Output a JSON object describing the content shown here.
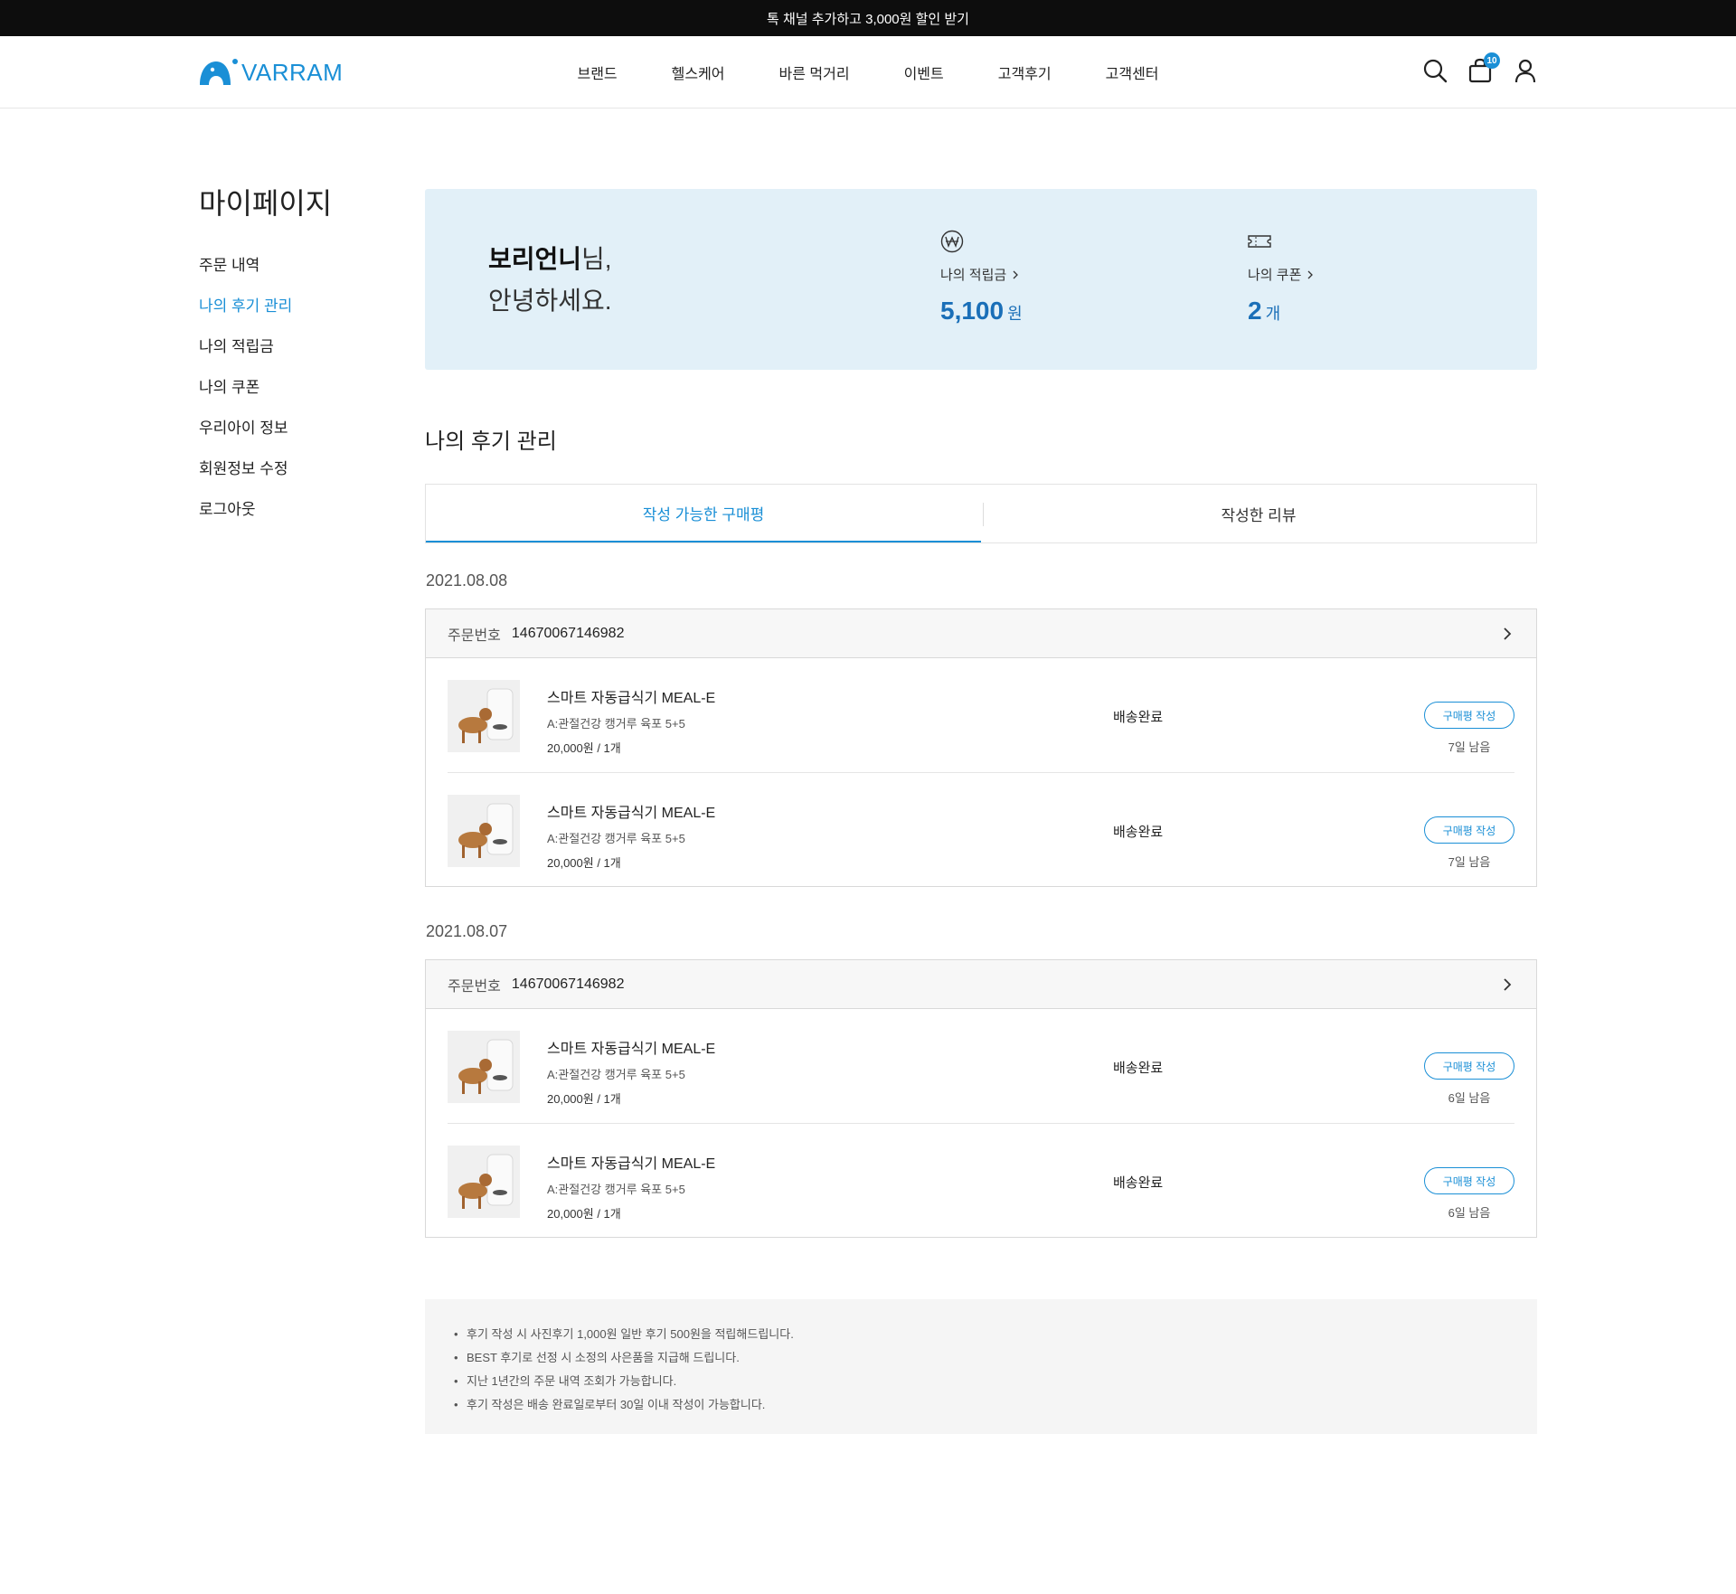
{
  "promo": {
    "text": "톡 채널 추가하고 3,000원 할인 받기"
  },
  "header": {
    "logo_text": "VARRAM",
    "nav": [
      "브랜드",
      "헬스케어",
      "바른 먹거리",
      "이벤트",
      "고객후기",
      "고객센터"
    ],
    "cart_count": "10",
    "icons": [
      "search-icon",
      "cart-icon",
      "user-icon"
    ]
  },
  "sidebar": {
    "title": "마이페이지",
    "items": [
      {
        "label": "주문 내역",
        "active": false
      },
      {
        "label": "나의 후기 관리",
        "active": true
      },
      {
        "label": "나의 적립금",
        "active": false
      },
      {
        "label": "나의 쿠폰",
        "active": false
      },
      {
        "label": "우리아이 정보",
        "active": false
      },
      {
        "label": "회원정보 수정",
        "active": false
      },
      {
        "label": "로그아웃",
        "active": false
      }
    ]
  },
  "welcome": {
    "name": "보리언니",
    "suffix": "님,",
    "line2": "안녕하세요.",
    "points": {
      "label": "나의 적립금",
      "value": "5,100",
      "unit": "원",
      "icon": "won-icon"
    },
    "coupons": {
      "label": "나의 쿠폰",
      "value": "2",
      "unit": "개",
      "icon": "ticket-icon"
    }
  },
  "section": {
    "title": "나의 후기 관리",
    "tabs": [
      {
        "label": "작성 가능한 구매평",
        "active": true
      },
      {
        "label": "작성한 리뷰",
        "active": false
      }
    ]
  },
  "orders": [
    {
      "date": "2021.08.08",
      "order_label": "주문번호",
      "order_no": "14670067146982",
      "items": [
        {
          "name": "스마트 자동급식기 MEAL-E",
          "option": "A:관절건강 캥거루 육포 5+5",
          "price": "20,000원 / 1개",
          "status": "배송완료",
          "button": "구매평 작성",
          "remain": "7일 남음"
        },
        {
          "name": "스마트 자동급식기 MEAL-E",
          "option": "A:관절건강 캥거루 육포 5+5",
          "price": "20,000원 / 1개",
          "status": "배송완료",
          "button": "구매평 작성",
          "remain": "7일 남음"
        }
      ]
    },
    {
      "date": "2021.08.07",
      "order_label": "주문번호",
      "order_no": "14670067146982",
      "items": [
        {
          "name": "스마트 자동급식기 MEAL-E",
          "option": "A:관절건강 캥거루 육포 5+5",
          "price": "20,000원 / 1개",
          "status": "배송완료",
          "button": "구매평 작성",
          "remain": "6일 남음"
        },
        {
          "name": "스마트 자동급식기 MEAL-E",
          "option": "A:관절건강 캥거루 육포 5+5",
          "price": "20,000원 / 1개",
          "status": "배송완료",
          "button": "구매평 작성",
          "remain": "6일 남음"
        }
      ]
    }
  ],
  "notice": [
    "후기 작성 시 사진후기 1,000원 일반 후기 500원을 적립해드립니다.",
    "BEST 후기로 선정 시 소정의 사은품을 지급해 드립니다.",
    "지난 1년간의 주문 내역 조회가 가능합니다.",
    "후기 작성은 배송 완료일로부터 30일 이내 작성이 가능합니다."
  ],
  "colors": {
    "accent": "#1a8fd6",
    "welcome_bg": "#e2f0f8",
    "promo_bg": "#0d0d0d"
  }
}
